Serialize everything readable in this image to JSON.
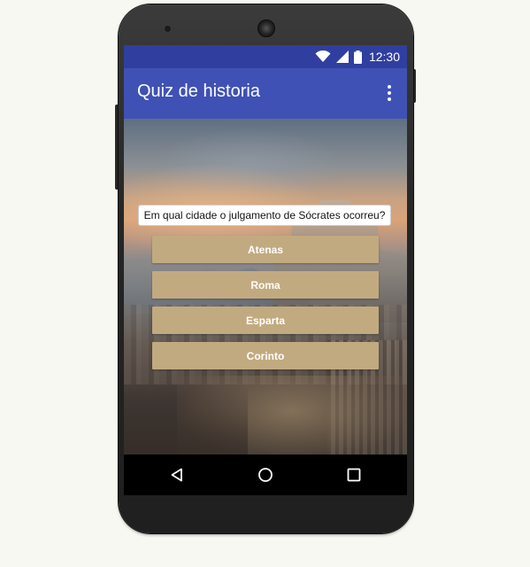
{
  "status_bar": {
    "time": "12:30",
    "icons": [
      "wifi-icon",
      "cellular-signal-icon",
      "battery-icon"
    ]
  },
  "app_bar": {
    "title": "Quiz de historia",
    "menu_icon": "overflow-menu-icon"
  },
  "quiz": {
    "question": "Em qual cidade o julgamento de Sócrates ocorreu?",
    "answers": [
      "Atenas",
      "Roma",
      "Esparta",
      "Corinto"
    ]
  },
  "nav_bar": {
    "icons": [
      "back-icon",
      "home-icon",
      "recents-icon"
    ]
  },
  "colors": {
    "status_bar": "#303f9f",
    "app_bar": "#3f51b5",
    "answer_button": "#c2aa80",
    "page_background": "#f8f8f2"
  }
}
